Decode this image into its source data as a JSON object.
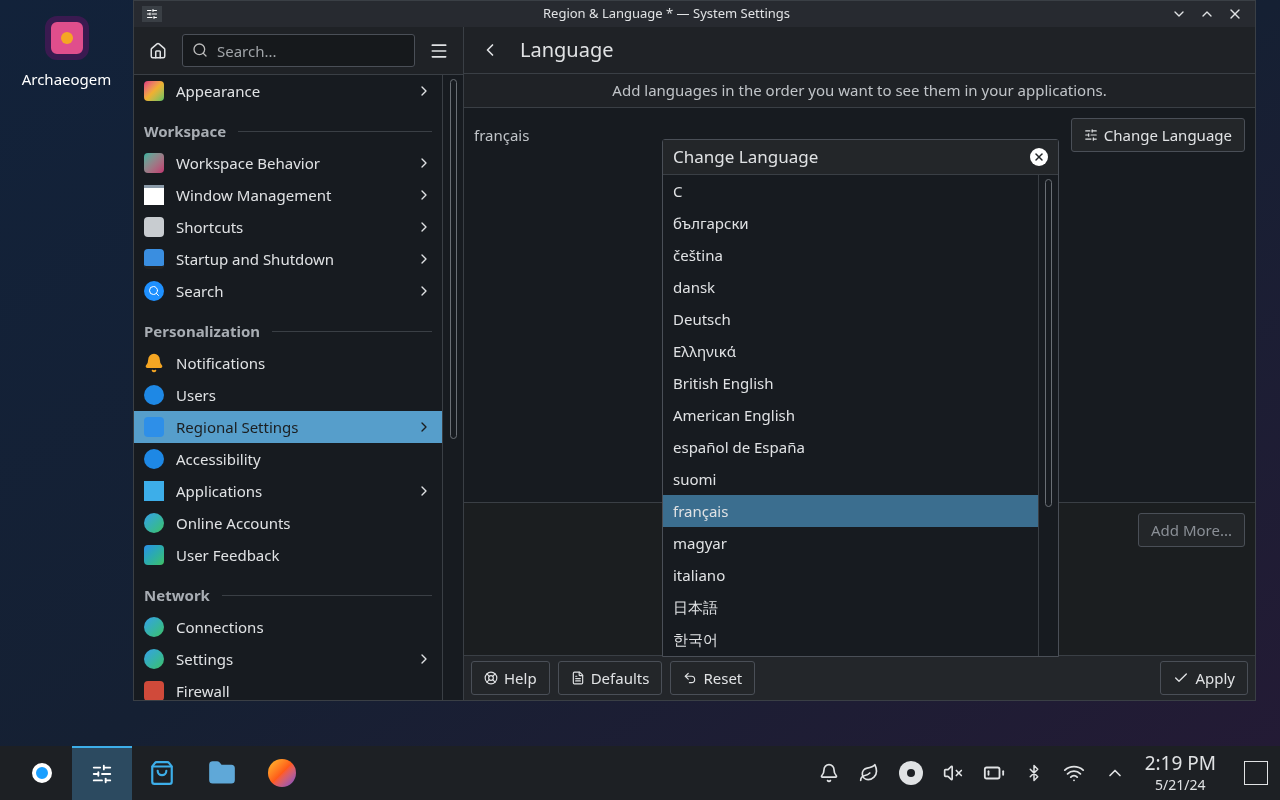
{
  "desktop_icons": [
    {
      "label": "Archaeogem"
    }
  ],
  "window": {
    "title": "Region & Language * — System Settings"
  },
  "sidebar": {
    "search": {
      "placeholder": "Search..."
    },
    "items": [
      {
        "kind": "item",
        "label": "Appearance",
        "arrow": true,
        "selected": false
      },
      {
        "kind": "header",
        "label": "Workspace"
      },
      {
        "kind": "item",
        "label": "Workspace Behavior",
        "arrow": true,
        "selected": false
      },
      {
        "kind": "item",
        "label": "Window Management",
        "arrow": true,
        "selected": false
      },
      {
        "kind": "item",
        "label": "Shortcuts",
        "arrow": true,
        "selected": false
      },
      {
        "kind": "item",
        "label": "Startup and Shutdown",
        "arrow": true,
        "selected": false
      },
      {
        "kind": "item",
        "label": "Search",
        "arrow": true,
        "selected": false
      },
      {
        "kind": "header",
        "label": "Personalization"
      },
      {
        "kind": "item",
        "label": "Notifications",
        "arrow": false,
        "selected": false
      },
      {
        "kind": "item",
        "label": "Users",
        "arrow": false,
        "selected": false
      },
      {
        "kind": "item",
        "label": "Regional Settings",
        "arrow": true,
        "selected": true
      },
      {
        "kind": "item",
        "label": "Accessibility",
        "arrow": false,
        "selected": false
      },
      {
        "kind": "item",
        "label": "Applications",
        "arrow": true,
        "selected": false
      },
      {
        "kind": "item",
        "label": "Online Accounts",
        "arrow": false,
        "selected": false
      },
      {
        "kind": "item",
        "label": "User Feedback",
        "arrow": false,
        "selected": false
      },
      {
        "kind": "header",
        "label": "Network"
      },
      {
        "kind": "item",
        "label": "Connections",
        "arrow": false,
        "selected": false
      },
      {
        "kind": "item",
        "label": "Settings",
        "arrow": true,
        "selected": false
      },
      {
        "kind": "item",
        "label": "Firewall",
        "arrow": false,
        "selected": false
      }
    ]
  },
  "page": {
    "title": "Language",
    "hint": "Add languages in the order you want to see them in your applications.",
    "languages": [
      "français"
    ],
    "change_button": "Change Language",
    "add_more": {
      "label": "Add More...",
      "disabled": true
    },
    "footer_left": [
      "Help",
      "Defaults",
      "Reset"
    ],
    "apply": "Apply"
  },
  "dialog": {
    "title": "Change Language",
    "items": [
      {
        "label": "C",
        "selected": false
      },
      {
        "label": "български",
        "selected": false
      },
      {
        "label": "čeština",
        "selected": false
      },
      {
        "label": "dansk",
        "selected": false
      },
      {
        "label": "Deutsch",
        "selected": false
      },
      {
        "label": "Ελληνικά",
        "selected": false
      },
      {
        "label": "British English",
        "selected": false
      },
      {
        "label": "American English",
        "selected": false
      },
      {
        "label": "español de España",
        "selected": false
      },
      {
        "label": "suomi",
        "selected": false
      },
      {
        "label": "français",
        "selected": true
      },
      {
        "label": "magyar",
        "selected": false
      },
      {
        "label": "italiano",
        "selected": false
      },
      {
        "label": "日本語",
        "selected": false
      },
      {
        "label": "한국어",
        "selected": false
      }
    ]
  },
  "taskbar": {
    "apps": [
      {
        "selected": false
      },
      {
        "selected": true
      },
      {
        "selected": false
      },
      {
        "selected": false
      },
      {
        "selected": false
      }
    ],
    "clock": {
      "time": "2:19 PM",
      "date": "5/21/24"
    }
  }
}
